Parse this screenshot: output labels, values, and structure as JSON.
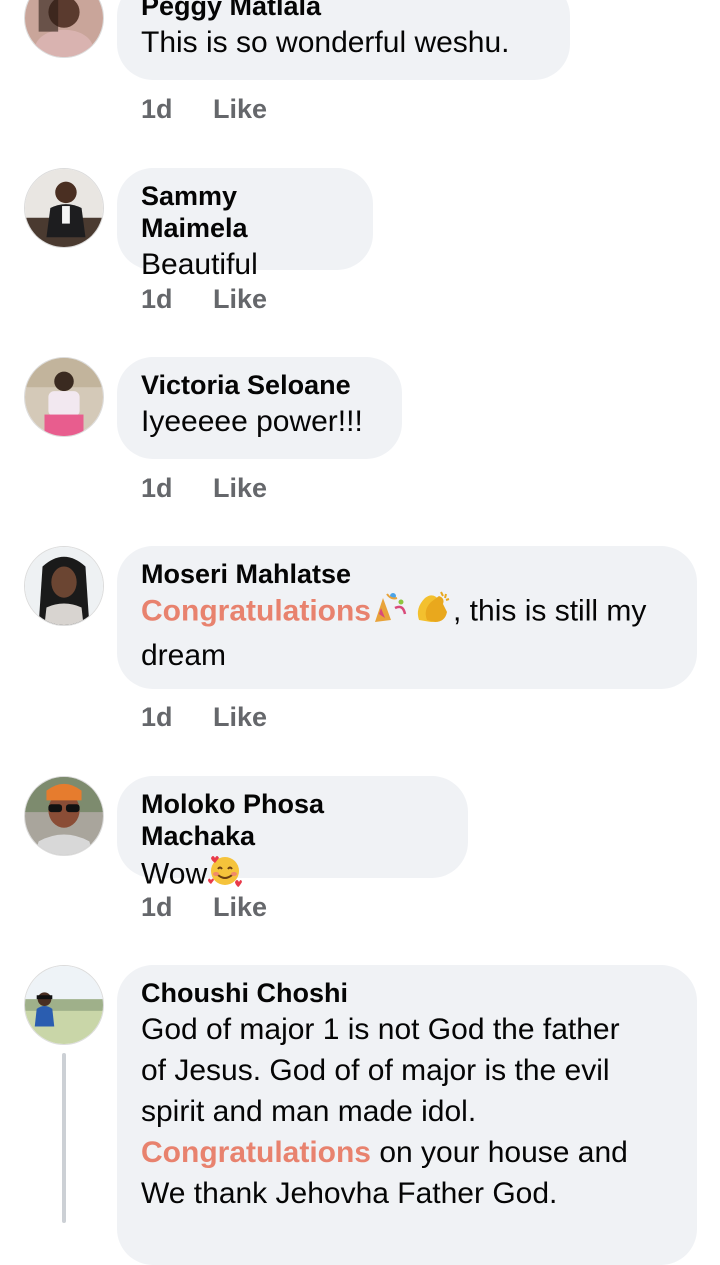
{
  "comments": [
    {
      "name": "Peggy Matlala",
      "text": "This is so wonderful weshu.",
      "time": "1d",
      "like": "Like",
      "avatar": "peggy-avatar"
    },
    {
      "name": "Sammy Maimela",
      "text": "Beautiful",
      "time": "1d",
      "like": "Like",
      "avatar": "sammy-avatar"
    },
    {
      "name": "Victoria Seloane",
      "text": "Iyeeeee power!!!",
      "time": "1d",
      "like": "Like",
      "avatar": "victoria-avatar"
    },
    {
      "name": "Moseri Mahlatse",
      "highlight": "Congratulations",
      "text_after": ", this is still my",
      "text_line2": "dream",
      "time": "1d",
      "like": "Like",
      "avatar": "moseri-avatar",
      "emojis": [
        "party-popper-emoji",
        "clapping-hands-emoji"
      ]
    },
    {
      "name": "Moloko Phosa Machaka",
      "text": "Wow",
      "time": "1d",
      "like": "Like",
      "avatar": "moloko-avatar",
      "emojis": [
        "smiling-face-with-hearts-emoji"
      ]
    },
    {
      "name": "Choushi Choshi",
      "line1": "God of major 1 is not God the father",
      "line2": "of Jesus. God of of major is the evil",
      "line3": "spirit and man made idol.",
      "highlight": "Congratulations",
      "line4_after": " on your house and",
      "line5": "We thank Jehovha Father God.",
      "avatar": "choushi-avatar"
    }
  ],
  "colors": {
    "bubble": "#f0f2f5",
    "highlight": "#e8826e",
    "meta": "#65676b"
  }
}
